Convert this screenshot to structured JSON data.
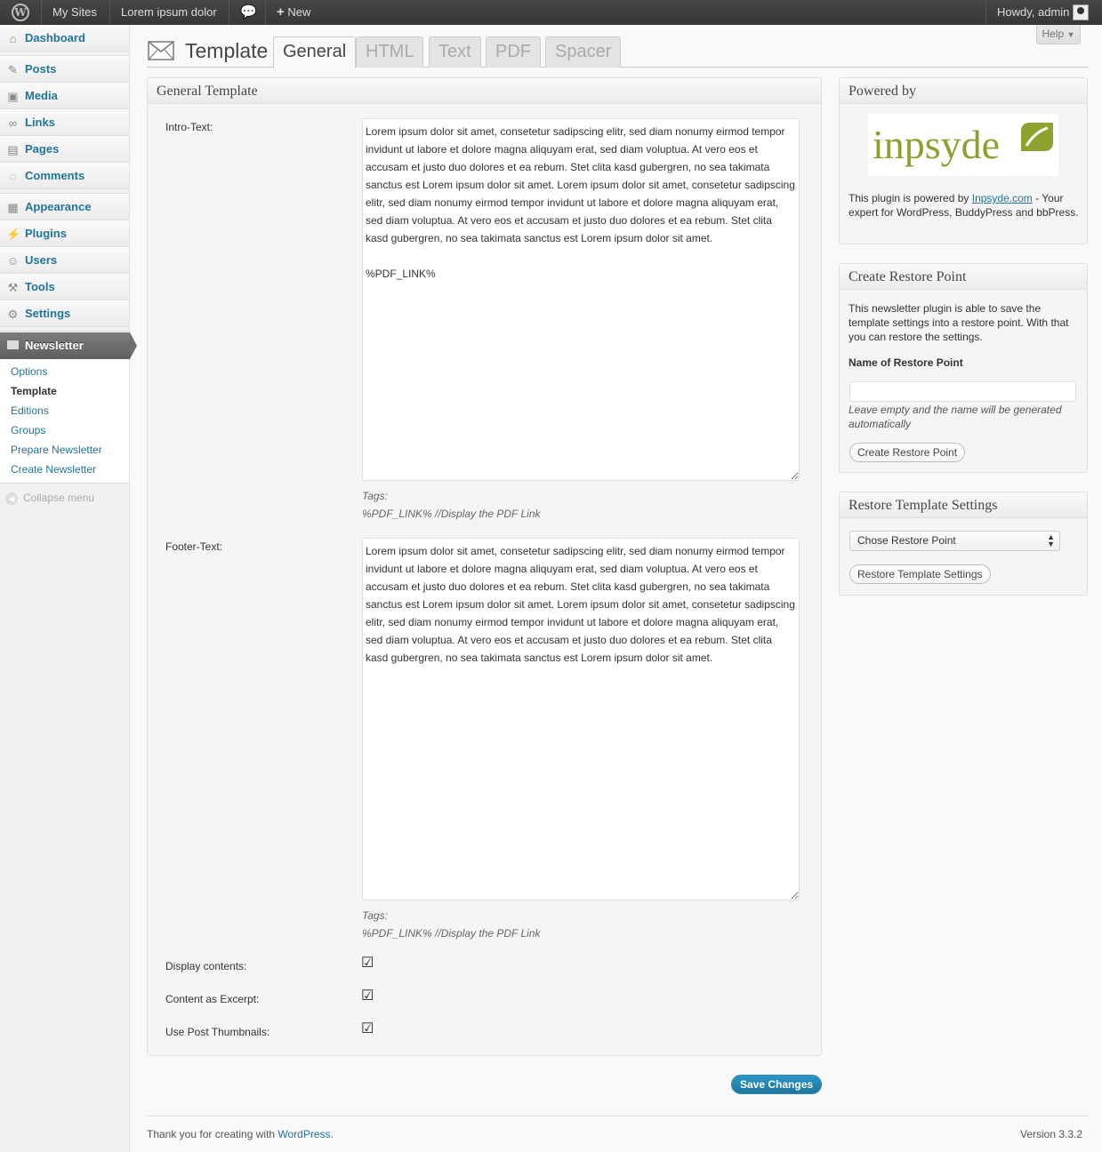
{
  "admin_bar": {
    "my_sites": "My Sites",
    "site_name": "Lorem ipsum dolor",
    "new_label": "New",
    "greeting": "Howdy, admin"
  },
  "menu": {
    "items": [
      {
        "label": "Dashboard",
        "icon": "dashboard-icon",
        "glyph": "⌂"
      },
      {
        "label": "Posts",
        "icon": "pin-icon",
        "glyph": "✎"
      },
      {
        "label": "Media",
        "icon": "media-icon",
        "glyph": "▣"
      },
      {
        "label": "Links",
        "icon": "link-icon",
        "glyph": "∞"
      },
      {
        "label": "Pages",
        "icon": "pages-icon",
        "glyph": "▤"
      },
      {
        "label": "Comments",
        "icon": "comment-icon",
        "glyph": "◌"
      },
      {
        "label": "Appearance",
        "icon": "appearance-icon",
        "glyph": "▦"
      },
      {
        "label": "Plugins",
        "icon": "plugin-icon",
        "glyph": "⚡"
      },
      {
        "label": "Users",
        "icon": "users-icon",
        "glyph": "☺"
      },
      {
        "label": "Tools",
        "icon": "tools-icon",
        "glyph": "⚒"
      },
      {
        "label": "Settings",
        "icon": "settings-icon",
        "glyph": "⚙"
      }
    ],
    "newsletter": "Newsletter",
    "submenu": [
      "Options",
      "Template",
      "Editions",
      "Groups",
      "Prepare Newsletter",
      "Create Newsletter"
    ],
    "collapse": "Collapse menu"
  },
  "header": {
    "help": "Help",
    "title": "Template",
    "tabs": [
      "General",
      "HTML",
      "Text",
      "PDF",
      "Spacer"
    ]
  },
  "general": {
    "title": "General Template",
    "intro_label": "Intro-Text:",
    "intro_text": "Lorem ipsum dolor sit amet, consetetur sadipscing elitr, sed diam nonumy eirmod tempor invidunt ut labore et dolore magna aliquyam erat, sed diam voluptua. At vero eos et accusam et justo duo dolores et ea rebum. Stet clita kasd gubergren, no sea takimata sanctus est Lorem ipsum dolor sit amet. Lorem ipsum dolor sit amet, consetetur sadipscing elitr, sed diam nonumy eirmod tempor invidunt ut labore et dolore magna aliquyam erat, sed diam voluptua. At vero eos et accusam et justo duo dolores et ea rebum. Stet clita kasd gubergren, no sea takimata sanctus est Lorem ipsum dolor sit amet.\n\n%PDF_LINK%",
    "tags_label": "Tags:",
    "tags_value": "%PDF_LINK% //Display the PDF Link",
    "footer_label": "Footer-Text:",
    "footer_text": "Lorem ipsum dolor sit amet, consetetur sadipscing elitr, sed diam nonumy eirmod tempor invidunt ut labore et dolore magna aliquyam erat, sed diam voluptua. At vero eos et accusam et justo duo dolores et ea rebum. Stet clita kasd gubergren, no sea takimata sanctus est Lorem ipsum dolor sit amet. Lorem ipsum dolor sit amet, consetetur sadipscing elitr, sed diam nonumy eirmod tempor invidunt ut labore et dolore magna aliquyam erat, sed diam voluptua. At vero eos et accusam et justo duo dolores et ea rebum. Stet clita kasd gubergren, no sea takimata sanctus est Lorem ipsum dolor sit amet.",
    "checkboxes": [
      {
        "label": "Display contents:",
        "checked": true
      },
      {
        "label": "Content as Excerpt:",
        "checked": true
      },
      {
        "label": "Use Post Thumbnails:",
        "checked": true
      }
    ],
    "save": "Save Changes"
  },
  "sidebar": {
    "powered_title": "Powered by",
    "logo_text": "inpsyde",
    "powered_pre": "This plugin is powered by ",
    "powered_link": "Inpsyde.com",
    "powered_post": " - Your expert for WordPress, BuddyPress and bbPress.",
    "restore_point_title": "Create Restore Point",
    "restore_point_desc": "This newsletter plugin is able to save the template settings into a restore point. With that you can restore the settings.",
    "restore_name_label": "Name of Restore Point",
    "restore_name_value": "",
    "restore_hint": "Leave empty and the name will be generated automatically",
    "create_btn": "Create Restore Point",
    "restore_settings_title": "Restore Template Settings",
    "select_value": "Chose Restore Point",
    "restore_btn": "Restore Template Settings"
  },
  "footer": {
    "thanks_pre": "Thank you for creating with ",
    "wp_link": "WordPress",
    "thanks_post": ".",
    "version": "Version 3.3.2"
  },
  "colors": {
    "link": "#21759b",
    "primary_button": "#21759b",
    "logo_green": "#8ba22e"
  }
}
